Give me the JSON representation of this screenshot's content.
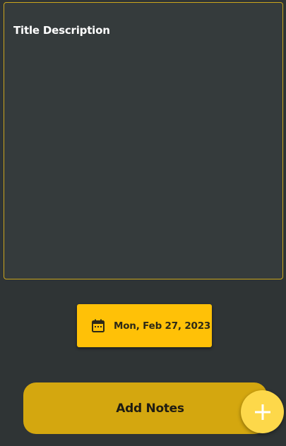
{
  "note": {
    "placeholder": "Title Description"
  },
  "date_picker": {
    "icon": "calendar-icon",
    "label": "Mon, Feb 27, 2023"
  },
  "actions": {
    "add_notes_label": "Add Notes",
    "fab_icon": "plus-icon"
  },
  "colors": {
    "background": "#2f3435",
    "accent": "#ffc107",
    "accent_dark": "#d4a70f",
    "fab": "#fdd84a",
    "border": "#caa51d"
  }
}
